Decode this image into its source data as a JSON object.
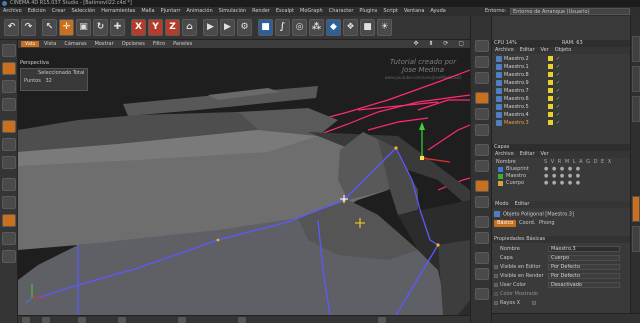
{
  "window": {
    "title": "CINEMA 4D R15.037 Studio - [Batimovil22.c4d *]"
  },
  "menubar": {
    "items": [
      "Archivo",
      "Edición",
      "Crear",
      "Selección",
      "Herramientas",
      "Malla",
      "Pjuntarr",
      "Animación",
      "Simulación",
      "Render",
      "Escalpt",
      "MoGraph",
      "Character",
      "Plugins",
      "Script",
      "Ventana",
      "Ayuda"
    ],
    "layout_label": "Entorno:",
    "layout_value": "Entorno de Arranque (Usuario)"
  },
  "toolbar": {
    "axis_buttons": [
      "X",
      "Y",
      "Z"
    ]
  },
  "viewport": {
    "tag": "Vista",
    "menu": [
      "Vista",
      "Cámaras",
      "Mostrar",
      "Opciones",
      "Filtro",
      "Paneles"
    ],
    "perspective_label": "Perspectiva",
    "info_title": "Seleccionado Total",
    "info_points_label": "Puntos",
    "info_points_value": "32",
    "watermark_line1": "Tutorial creado por",
    "watermark_line2": "Jose Medina",
    "watermark_small": "www.youtube.com/user/JoseMedina3D"
  },
  "objects_panel": {
    "header": "CPU 14%",
    "ram": "RAM: 63",
    "menu": [
      "Archivo",
      "Editar",
      "Ver",
      "Objeto"
    ],
    "items": [
      {
        "name": "Maestro.2",
        "selected": false
      },
      {
        "name": "Maestro.1",
        "selected": false
      },
      {
        "name": "Maestro.8",
        "selected": false
      },
      {
        "name": "Maestro.9",
        "selected": false
      },
      {
        "name": "Maestro.7",
        "selected": false
      },
      {
        "name": "Maestro.6",
        "selected": false
      },
      {
        "name": "Maestro.5",
        "selected": false
      },
      {
        "name": "Maestro.4",
        "selected": false
      },
      {
        "name": "Maestro.3",
        "selected": true
      }
    ]
  },
  "layers_panel": {
    "header": "Capas",
    "menu": [
      "Archivo",
      "Editar",
      "Ver"
    ],
    "column_name": "Nombre",
    "column_flags": "S V R M L A G D E X",
    "layers": [
      {
        "name": "Blueprint",
        "color": "#3c7bd6"
      },
      {
        "name": "Maestro",
        "color": "#3caa3c"
      },
      {
        "name": "Cuerpo",
        "color": "#d6a23c"
      }
    ]
  },
  "attributes_panel": {
    "menu": [
      "Modo",
      "Editar"
    ],
    "object_title": "Objeto Poligonal [Maestro.3]",
    "tabs": [
      "Básico",
      "Coord.",
      "Phong"
    ],
    "section": "Propiedades Básicas",
    "props": [
      {
        "label": "Nombre",
        "value": "Maestro.3",
        "dropdown": false,
        "checkbox": false
      },
      {
        "label": "Capa",
        "value": "Cuerpo",
        "dropdown": true,
        "checkbox": false
      },
      {
        "label": "Visible en Editor",
        "value": "Por Defecto",
        "dropdown": true,
        "checkbox": true
      },
      {
        "label": "Visible en Render",
        "value": "Por Defecto",
        "dropdown": true,
        "checkbox": true
      },
      {
        "label": "Usar Color",
        "value": "Desactivado",
        "dropdown": true,
        "checkbox": true
      },
      {
        "label": "Color Mostrado",
        "value": "",
        "dropdown": false,
        "checkbox": true
      },
      {
        "label": "Rayos X",
        "value": "",
        "dropdown": false,
        "checkbox": true
      }
    ]
  },
  "colors": {
    "accent": "#c96f1e",
    "wire_pink": "#ff2b6e",
    "edge_blue": "#5a5aff",
    "axis_green": "#3cd23c",
    "axis_red": "#e03030"
  }
}
